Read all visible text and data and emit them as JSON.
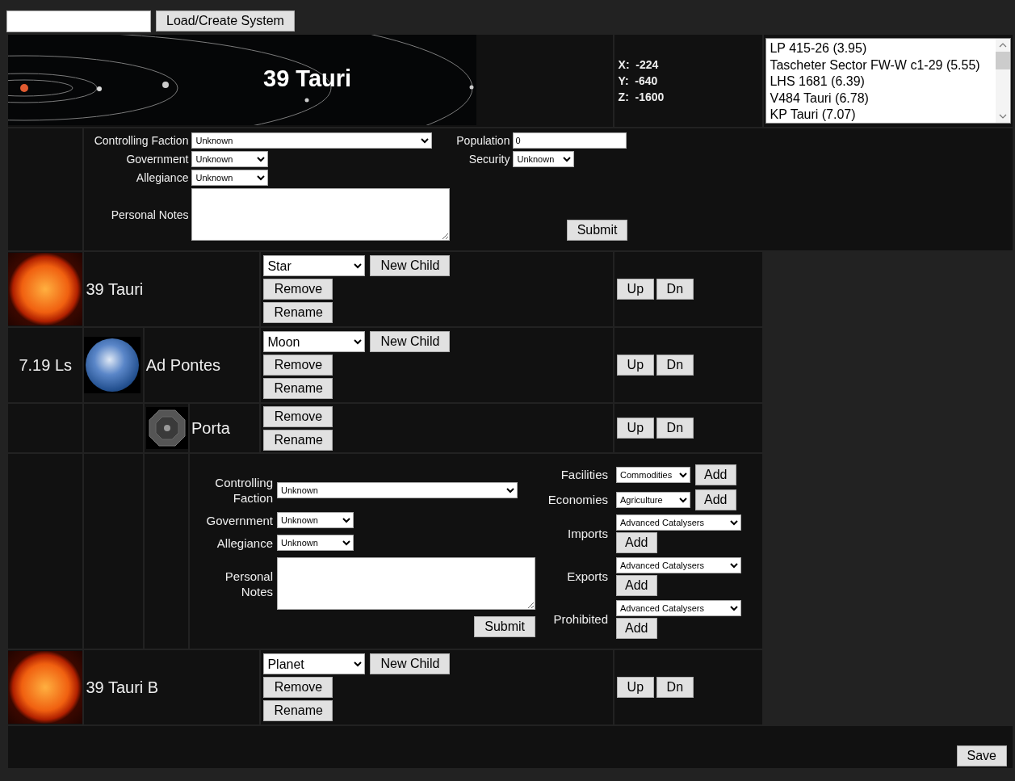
{
  "load_bar": {
    "button": "Load/Create System"
  },
  "system": {
    "title": "39 Tauri",
    "coordinates": [
      {
        "axis": "X:",
        "value": "-224"
      },
      {
        "axis": "Y:",
        "value": "-640"
      },
      {
        "axis": "Z:",
        "value": "-1600"
      }
    ],
    "nearby_systems": [
      "LP 415-26 (3.95)",
      "Tascheter Sector FW-W c1-29 (5.55)",
      "LHS 1681 (6.39)",
      "V484 Tauri (6.78)",
      "KP Tauri (7.07)"
    ]
  },
  "system_form": {
    "controlling_faction": {
      "label": "Controlling Faction",
      "value": "Unknown"
    },
    "government": {
      "label": "Government",
      "value": "Unknown"
    },
    "allegiance": {
      "label": "Allegiance",
      "value": "Unknown"
    },
    "personal_notes": {
      "label": "Personal Notes"
    },
    "population": {
      "label": "Population",
      "value": "0"
    },
    "security": {
      "label": "Security",
      "value": "Unknown"
    },
    "submit": "Submit"
  },
  "bodies": [
    {
      "name": "39 Tauri",
      "kind": "sun",
      "type": "Star",
      "new_child": "New Child",
      "remove": "Remove",
      "rename": "Rename",
      "up": "Up",
      "down": "Dn",
      "children": [
        {
          "name": "Ad Pontes",
          "distance": "7.19 Ls",
          "kind": "earth",
          "type": "Moon",
          "new_child": "New Child",
          "remove": "Remove",
          "rename": "Rename",
          "up": "Up",
          "down": "Dn",
          "children": [
            {
              "name": "Porta",
              "kind": "station",
              "remove": "Remove",
              "rename": "Rename",
              "up": "Up",
              "down": "Dn",
              "details": {
                "controlling_faction": {
                  "label": "Controlling Faction",
                  "value": "Unknown"
                },
                "government": {
                  "label": "Government",
                  "value": "Unknown"
                },
                "allegiance": {
                  "label": "Allegiance",
                  "value": "Unknown"
                },
                "personal_notes": {
                  "label": "Personal Notes"
                },
                "submit": "Submit",
                "lists": [
                  {
                    "label": "Facilities",
                    "value": "Commodities",
                    "add": "Add",
                    "kind": "short"
                  },
                  {
                    "label": "Economies",
                    "value": "Agriculture",
                    "add": "Add",
                    "kind": "short"
                  },
                  {
                    "label": "Imports",
                    "value": "Advanced Catalysers",
                    "add": "Add",
                    "kind": "wide"
                  },
                  {
                    "label": "Exports",
                    "value": "Advanced Catalysers",
                    "add": "Add",
                    "kind": "wide"
                  },
                  {
                    "label": "Prohibited",
                    "value": "Advanced Catalysers",
                    "add": "Add",
                    "kind": "wide"
                  }
                ]
              }
            }
          ]
        }
      ]
    },
    {
      "name": "39 Tauri B",
      "kind": "sun",
      "type": "Planet",
      "new_child": "New Child",
      "remove": "Remove",
      "rename": "Rename",
      "up": "Up",
      "down": "Dn"
    }
  ],
  "save": "Save"
}
